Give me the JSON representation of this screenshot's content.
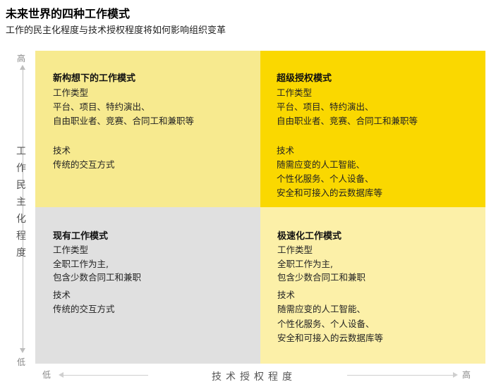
{
  "header": {
    "title": "未来世界的四种工作模式",
    "subtitle": "工作的民主化程度与技术授权程度将如何影响组织变革"
  },
  "y_axis": {
    "title": "工作民主化程度",
    "high": "高",
    "low": "低"
  },
  "x_axis": {
    "title": "技术授权程度",
    "low": "低",
    "high": "高"
  },
  "colors": {
    "top_left": "#f7ea8f",
    "top_right": "#fad800",
    "bottom_left": "#e0e0e0",
    "bottom_right": "#fcf0a8"
  },
  "quadrants": {
    "top_left": {
      "title": "新构想下的工作模式",
      "work_type_label": "工作类型",
      "work_type_lines": [
        "平台、项目、特约演出、",
        "自由职业者、竞赛、合同工和兼职等"
      ],
      "tech_label": "技术",
      "tech_lines": [
        "传统的交互方式"
      ]
    },
    "top_right": {
      "title": "超级授权模式",
      "work_type_label": "工作类型",
      "work_type_lines": [
        "平台、项目、特约演出、",
        "自由职业者、竞赛、合同工和兼职等"
      ],
      "tech_label": "技术",
      "tech_lines": [
        "随需应变的人工智能、",
        "个性化服务、个人设备、",
        "安全和可接入的云数据库等"
      ]
    },
    "bottom_left": {
      "title": "现有工作模式",
      "work_type_label": "工作类型",
      "work_type_lines": [
        "全职工作为主,",
        "包含少数合同工和兼职"
      ],
      "tech_label": "技术",
      "tech_lines": [
        "传统的交互方式"
      ]
    },
    "bottom_right": {
      "title": "极速化工作模式",
      "work_type_label": "工作类型",
      "work_type_lines": [
        "全职工作为主,",
        "包含少数合同工和兼职"
      ],
      "tech_label": "技术",
      "tech_lines": [
        "随需应变的人工智能、",
        "个性化服务、个人设备、",
        "安全和可接入的云数据库等"
      ]
    }
  }
}
